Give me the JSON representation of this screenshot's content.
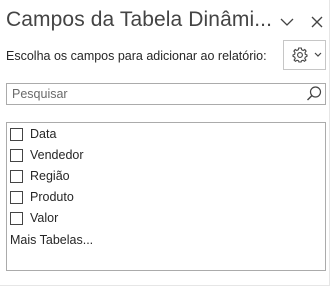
{
  "pane": {
    "title": "Campos da Tabela Dinâmi...",
    "subtitle": "Escolha os campos para adicionar ao relatório:",
    "header_icons": [
      "chevron-down-icon",
      "close-icon"
    ],
    "settings_icons": [
      "gear-icon",
      "chevron-down-icon"
    ]
  },
  "search": {
    "placeholder": "Pesquisar",
    "value": "",
    "icon": "search-icon"
  },
  "fields": [
    {
      "label": "Data",
      "checked": false
    },
    {
      "label": "Vendedor",
      "checked": false
    },
    {
      "label": "Região",
      "checked": false
    },
    {
      "label": "Produto",
      "checked": false
    },
    {
      "label": "Valor",
      "checked": false
    }
  ],
  "more_tables": "Mais Tabelas...",
  "colors": {
    "title": "#444444",
    "text": "#262626",
    "border": "#ababab"
  }
}
